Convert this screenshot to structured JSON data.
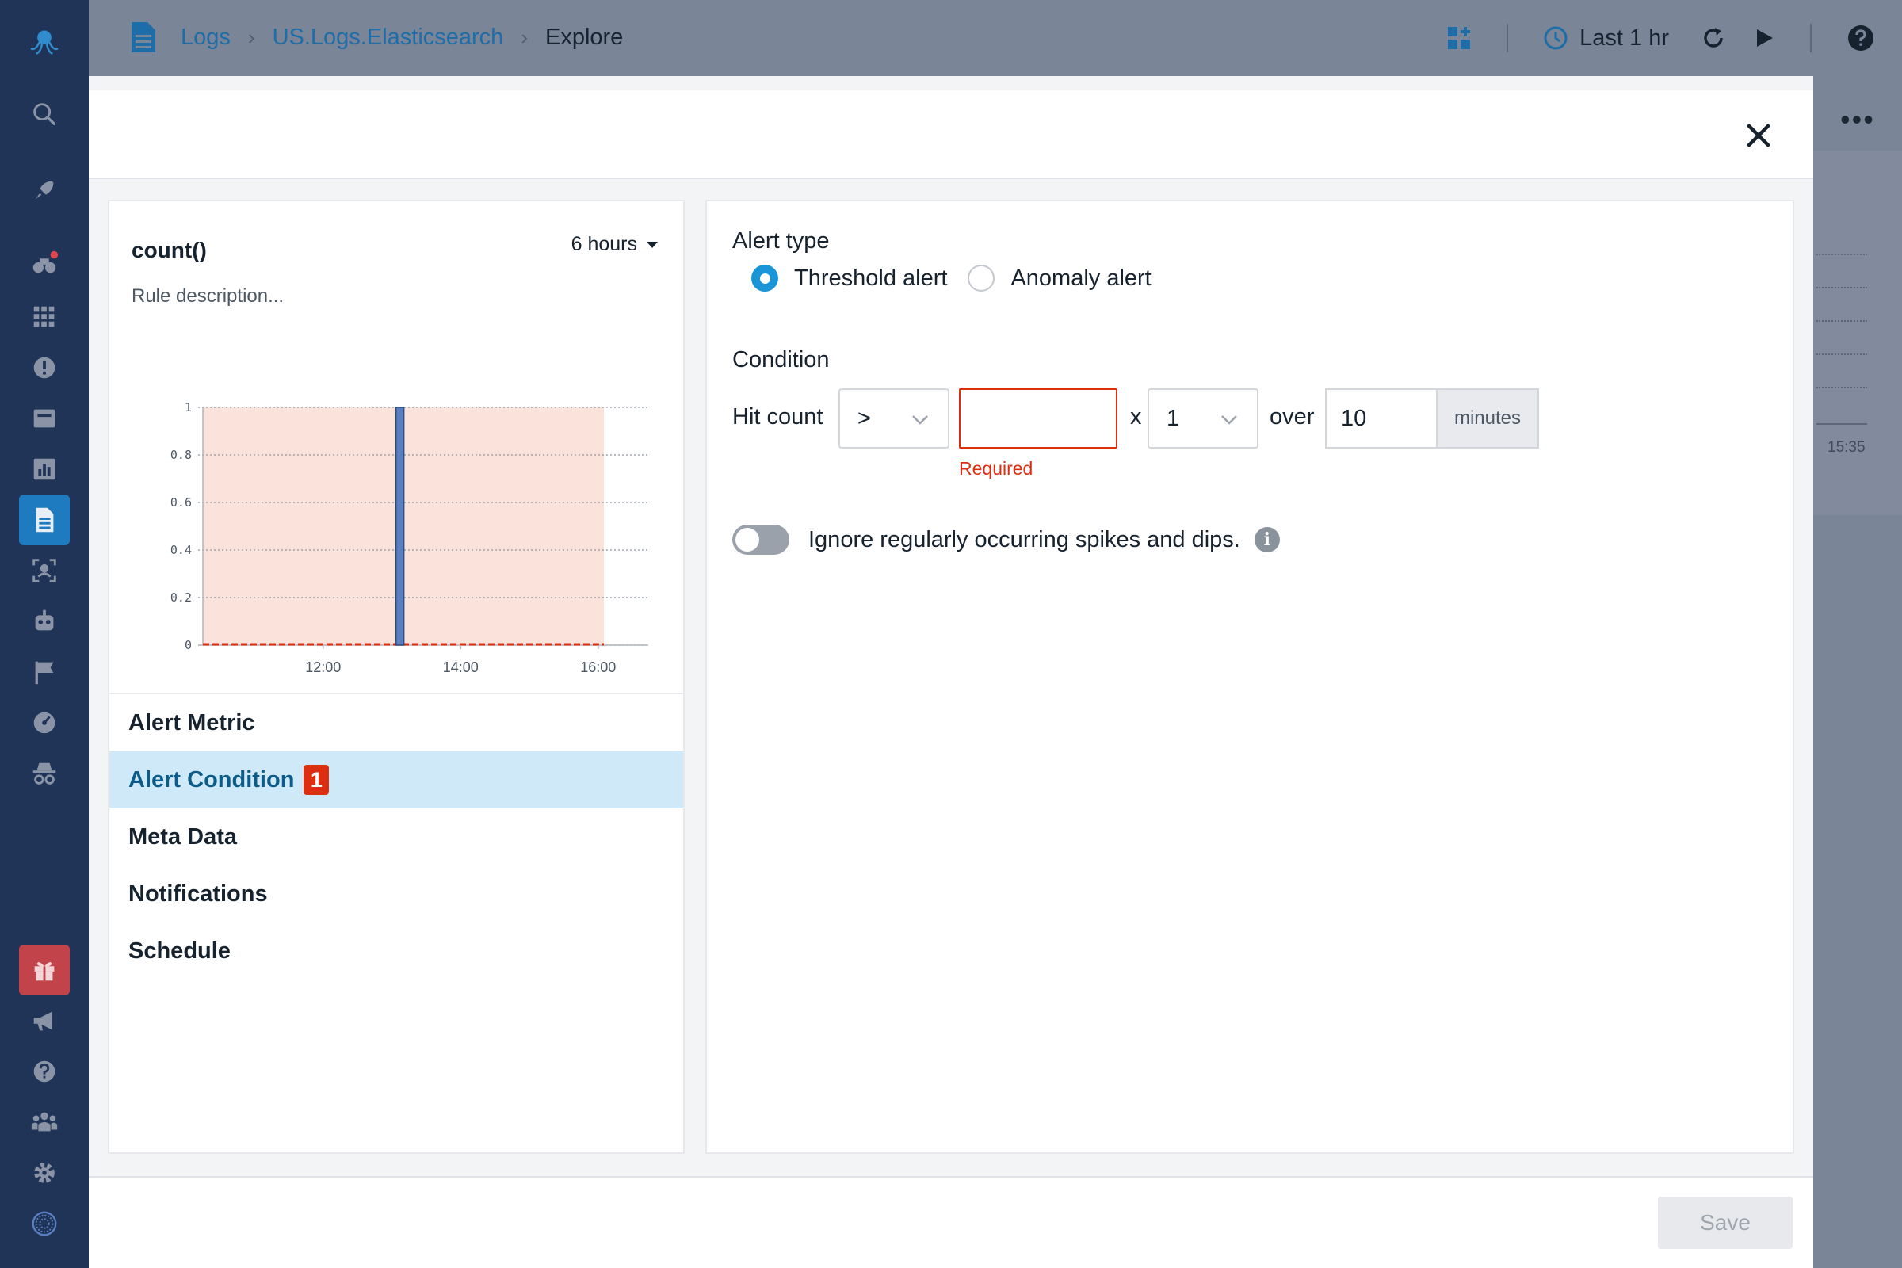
{
  "breadcrumb": {
    "items": [
      "Logs",
      "US.Logs.Elasticsearch"
    ],
    "current": "Explore"
  },
  "toolbar": {
    "time_range": "Last 1 hr"
  },
  "background": {
    "time_label": "15:35",
    "more_label": "•••"
  },
  "panel": {
    "title": "count()",
    "range": "6 hours",
    "description_placeholder": "Rule description..."
  },
  "chart_data": {
    "type": "bar",
    "title": "",
    "xlabel": "",
    "ylabel": "",
    "x_ticks": [
      "12:00",
      "14:00",
      "16:00"
    ],
    "y_ticks": [
      "0",
      "0.2",
      "0.4",
      "0.6",
      "0.8",
      "1"
    ],
    "ylim": [
      0,
      1
    ],
    "series": [
      {
        "values": [
          {
            "x": "13:07",
            "y": 1
          }
        ]
      }
    ],
    "threshold_region": [
      0,
      1
    ],
    "grid": true
  },
  "steps": [
    {
      "label": "Alert Metric"
    },
    {
      "label": "Alert Condition",
      "badge": "1"
    },
    {
      "label": "Meta Data"
    },
    {
      "label": "Notifications"
    },
    {
      "label": "Schedule"
    }
  ],
  "form": {
    "alert_type_label": "Alert type",
    "threshold_label": "Threshold alert",
    "anomaly_label": "Anomaly alert",
    "selected_type": "threshold",
    "condition_label": "Condition",
    "hit_count_label": "Hit count",
    "operator": ">",
    "threshold_value": "",
    "x_label": "x",
    "multiplier": "1",
    "over_label": "over",
    "minutes_value": "10",
    "minutes_unit": "minutes",
    "required_msg": "Required",
    "ignore_label": "Ignore regularly occurring spikes and dips.",
    "ignore_enabled": false
  },
  "footer": {
    "save_label": "Save"
  },
  "colors": {
    "accent": "#1a95d8",
    "error": "#dc2f12",
    "rail": "#1f3457",
    "active_step": "#cfe9f8"
  }
}
